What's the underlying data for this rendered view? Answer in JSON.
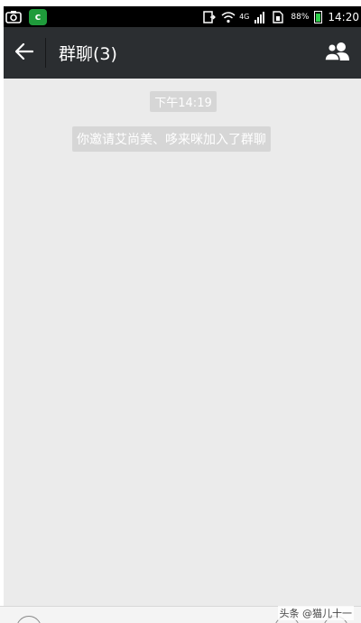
{
  "status_bar": {
    "network_label": "4G",
    "battery_percent": "88%",
    "time": "14:20",
    "app_icon_letter": "c"
  },
  "header": {
    "title": "群聊(3)"
  },
  "chat": {
    "timestamp": "下午14:19",
    "system_message": "你邀请艾尚美、哆来咪加入了群聊"
  },
  "watermark": "头条 @猫儿十一",
  "colors": {
    "header_bg": "#2b2e31",
    "chat_bg": "#ebebeb",
    "chip_bg": "#d6d6d6",
    "battery_fill": "#2fd14c",
    "app_icon": "#1f9b3b"
  }
}
